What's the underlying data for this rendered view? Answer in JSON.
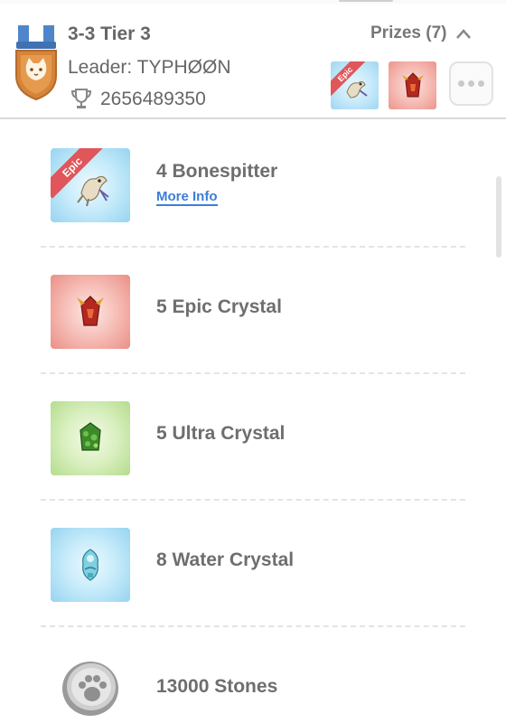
{
  "header": {
    "tier_title": "3-3 Tier 3",
    "leader": "Leader: TYPHØØN",
    "trophy_count": "2656489350",
    "prizes_label": "Prizes (7)",
    "thumb_ribbon": "Epic"
  },
  "prizes": [
    {
      "name": "4 Bonespitter",
      "ribbon": "Epic",
      "link": "More Info",
      "tile": "blue",
      "icon": "bonespitter-dragon-icon"
    },
    {
      "name": "5 Epic Crystal",
      "tile": "red",
      "icon": "epic-crystal-icon"
    },
    {
      "name": "5 Ultra Crystal",
      "tile": "green",
      "icon": "ultra-crystal-icon"
    },
    {
      "name": "8 Water Crystal",
      "tile": "blue",
      "icon": "water-crystal-icon"
    },
    {
      "name": "13000 Stones",
      "icon": "stones-paw-icon"
    }
  ],
  "colors": {
    "link": "#3d7dd8",
    "ribbon": "#e0565a",
    "medal": "#d98a3a",
    "text": "#6e6e6e"
  }
}
